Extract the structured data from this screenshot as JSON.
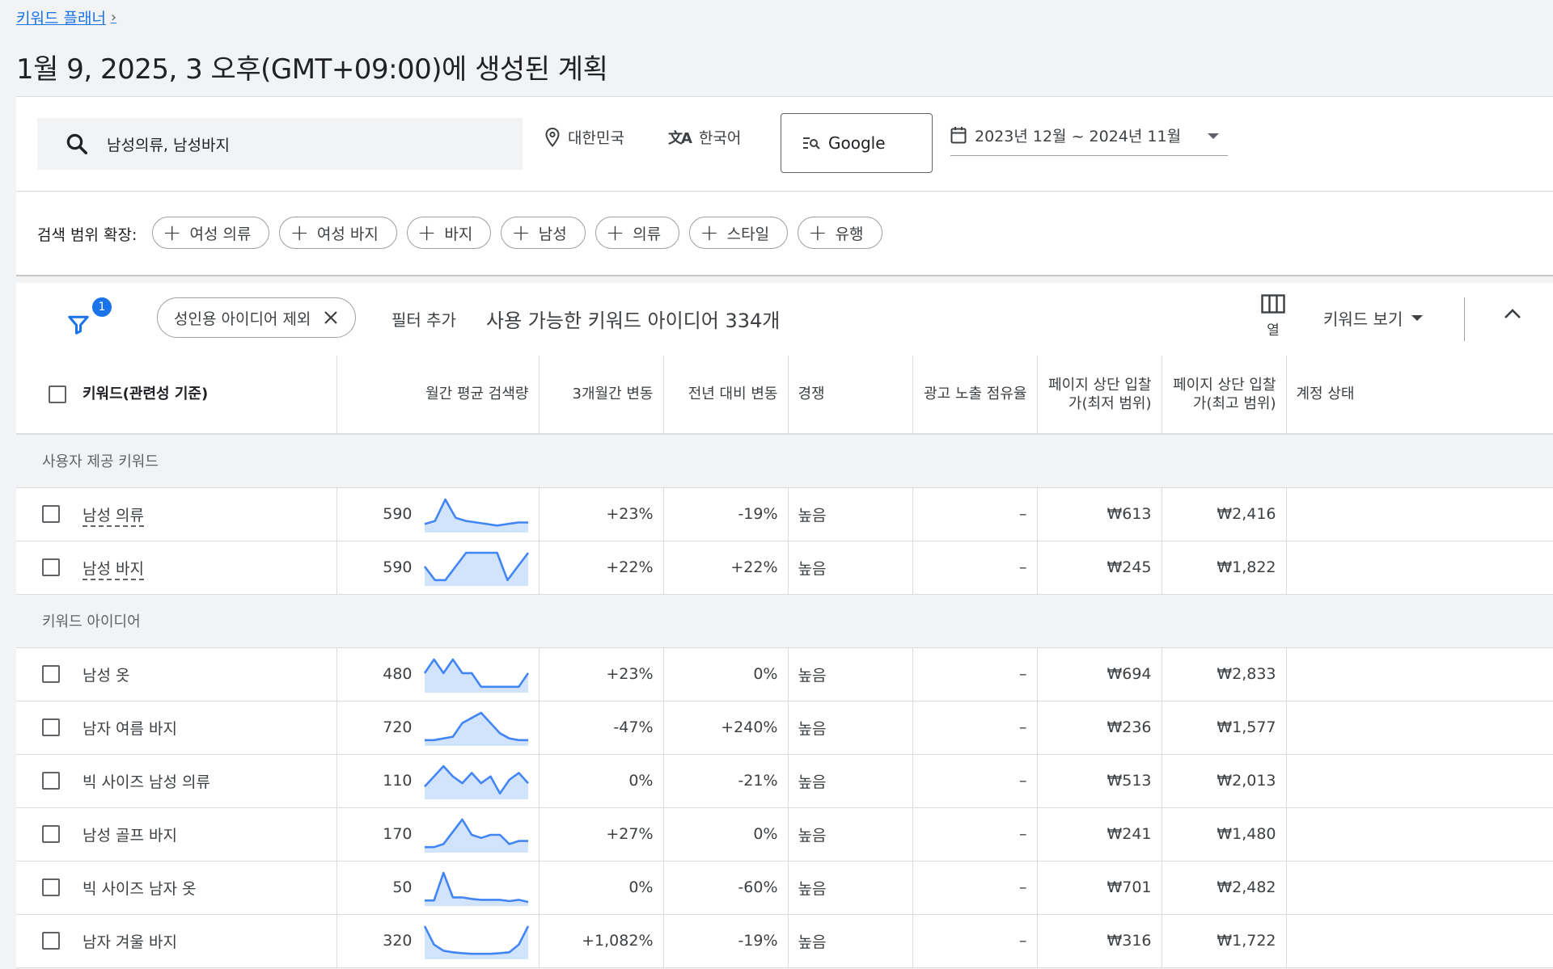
{
  "breadcrumb": {
    "label": "키워드 플래너"
  },
  "page": {
    "title": "1월 9, 2025, 3 오후(GMT+09:00)에 생성된 계획"
  },
  "search": {
    "query": "남성의류, 남성바지",
    "location": "대한민국",
    "language": "한국어",
    "engine": "Google",
    "date_range": "2023년 12월 ~ 2024년 11월"
  },
  "expand": {
    "label": "검색 범위 확장:",
    "chips": [
      "여성 의류",
      "여성 바지",
      "바지",
      "남성",
      "의류",
      "스타일",
      "유행"
    ]
  },
  "toolbar": {
    "filter_badge": "1",
    "active_filter": "성인용 아이디어 제외",
    "add_filter": "필터 추가",
    "idea_count": "사용 가능한 키워드 아이디어 334개",
    "columns_label": "열",
    "view_label": "키워드 보기"
  },
  "table": {
    "headers": {
      "keyword": "키워드(관련성 기준)",
      "volume": "월간 평균 검색량",
      "three_month": "3개월간 변동",
      "yoy": "전년 대비 변동",
      "competition": "경쟁",
      "impression_share": "광고 노출 점유율",
      "bid_low": "페이지 상단 입찰가(최저 범위)",
      "bid_high": "페이지 상단 입찰가(최고 범위)",
      "account_status": "계정 상태"
    },
    "groups": [
      {
        "label": "사용자 제공 키워드",
        "rows": [
          {
            "keyword": "남성 의류",
            "link": true,
            "volume": "590",
            "trend": [
              2,
              3,
              10,
              4,
              3,
              2.5,
              2,
              1.5,
              2,
              2.5,
              2.5
            ],
            "three_month": "+23%",
            "yoy": "-19%",
            "competition": "높음",
            "impression_share": "–",
            "bid_low": "₩613",
            "bid_high": "₩2,416"
          },
          {
            "keyword": "남성 바지",
            "link": true,
            "volume": "590",
            "trend": [
              5,
              1,
              1,
              5,
              9,
              9,
              9,
              9,
              1,
              5,
              9
            ],
            "three_month": "+22%",
            "yoy": "+22%",
            "competition": "높음",
            "impression_share": "–",
            "bid_low": "₩245",
            "bid_high": "₩1,822"
          }
        ]
      },
      {
        "label": "키워드 아이디어",
        "rows": [
          {
            "keyword": "남성 옷",
            "link": false,
            "volume": "480",
            "trend": [
              5,
              9,
              5,
              9,
              5,
              5,
              1,
              1,
              1,
              1,
              1,
              5
            ],
            "three_month": "+23%",
            "yoy": "0%",
            "competition": "높음",
            "impression_share": "–",
            "bid_low": "₩694",
            "bid_high": "₩2,833"
          },
          {
            "keyword": "남자 여름 바지",
            "link": false,
            "volume": "720",
            "trend": [
              1,
              1,
              1.5,
              2,
              6,
              7.5,
              9,
              6,
              3,
              1.5,
              1,
              1
            ],
            "three_month": "-47%",
            "yoy": "+240%",
            "competition": "높음",
            "impression_share": "–",
            "bid_low": "₩236",
            "bid_high": "₩1,577"
          },
          {
            "keyword": "빅 사이즈 남성 의류",
            "link": false,
            "volume": "110",
            "trend": [
              3,
              6,
              9,
              6,
              4,
              7,
              4,
              6,
              1,
              5,
              7,
              4
            ],
            "three_month": "0%",
            "yoy": "-21%",
            "competition": "높음",
            "impression_share": "–",
            "bid_low": "₩513",
            "bid_high": "₩2,013"
          },
          {
            "keyword": "남성 골프 바지",
            "link": false,
            "volume": "170",
            "trend": [
              1,
              1,
              2,
              6,
              10,
              5,
              4,
              5,
              5,
              2,
              3,
              3
            ],
            "three_month": "+27%",
            "yoy": "0%",
            "competition": "높음",
            "impression_share": "–",
            "bid_low": "₩241",
            "bid_high": "₩1,480"
          },
          {
            "keyword": "빅 사이즈 남자 옷",
            "link": false,
            "volume": "50",
            "trend": [
              1,
              1,
              10,
              2,
              2,
              1.5,
              1.2,
              1.2,
              1.2,
              0.8,
              1.2,
              0.5
            ],
            "three_month": "0%",
            "yoy": "-60%",
            "competition": "높음",
            "impression_share": "–",
            "bid_low": "₩701",
            "bid_high": "₩2,482"
          },
          {
            "keyword": "남자 겨울 바지",
            "link": false,
            "volume": "320",
            "trend": [
              10,
              4,
              2,
              1.5,
              1.2,
              1,
              1,
              1,
              1.2,
              1.5,
              4,
              10
            ],
            "three_month": "+1,082%",
            "yoy": "-19%",
            "competition": "높음",
            "impression_share": "–",
            "bid_low": "₩316",
            "bid_high": "₩1,722"
          }
        ]
      }
    ]
  },
  "colors": {
    "accent": "#1a73e8",
    "sparkline": "#4285f4",
    "sparkline_fill": "#d2e3fc"
  }
}
